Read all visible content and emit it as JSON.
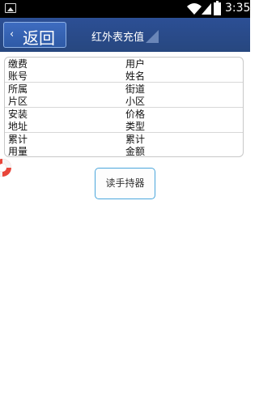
{
  "status_bar": {
    "time": "3:35",
    "icons": [
      "image-icon",
      "wifi-icon",
      "signal-icon",
      "battery-icon"
    ]
  },
  "title_bar": {
    "back_chevron": "‹",
    "back_label": "返回",
    "title": "红外表充值",
    "accent_color": "#2c4f95"
  },
  "info_table": {
    "rows": [
      {
        "left_label": "缴费账号",
        "right_label": "用户姓名"
      },
      {
        "left_label": "所属片区",
        "right_label": "街道小区"
      },
      {
        "left_label": "安装地址",
        "right_label": "价格类型"
      },
      {
        "left_label": "累计用量",
        "right_label": "累计金额"
      }
    ]
  },
  "actions": {
    "read_button_label": "读手持器",
    "read_button_border_color": "#4aa6dc"
  }
}
